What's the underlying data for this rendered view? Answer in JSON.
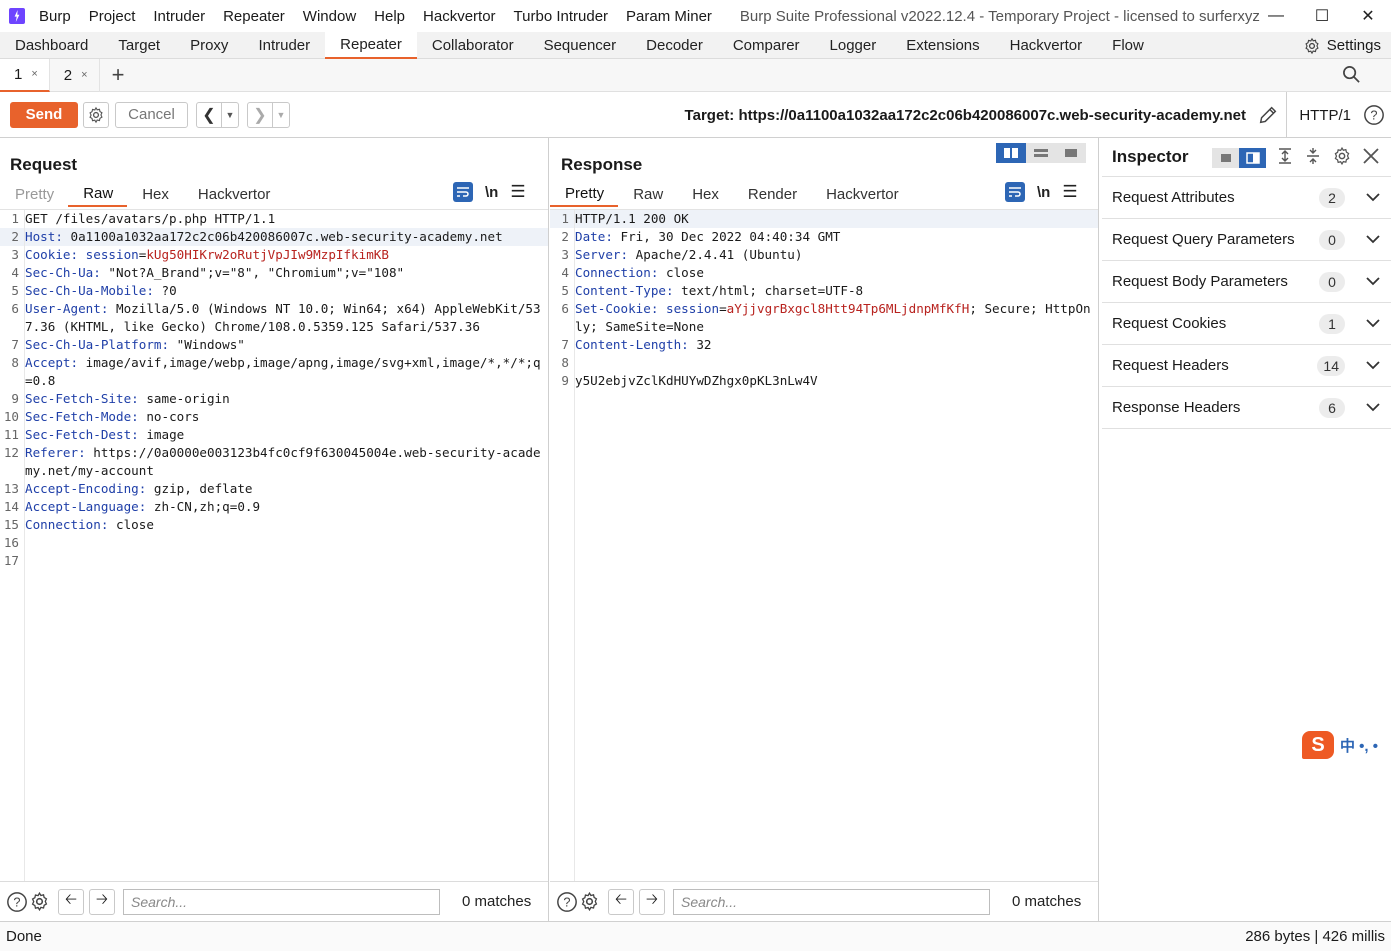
{
  "menubar": {
    "items": [
      "Burp",
      "Project",
      "Intruder",
      "Repeater",
      "Window",
      "Help",
      "Hackvertor",
      "Turbo Intruder",
      "Param Miner"
    ],
    "window_title": "Burp Suite Professional v2022.12.4 - Temporary Project - licensed to surferxyz"
  },
  "main_tabs": {
    "items": [
      "Dashboard",
      "Target",
      "Proxy",
      "Intruder",
      "Repeater",
      "Collaborator",
      "Sequencer",
      "Decoder",
      "Comparer",
      "Logger",
      "Extensions",
      "Hackvertor",
      "Flow"
    ],
    "active": "Repeater",
    "settings_label": "Settings"
  },
  "repeater_tabs": {
    "items": [
      "1",
      "2"
    ],
    "active": "1",
    "add_label": "+"
  },
  "toolbar": {
    "send_label": "Send",
    "cancel_label": "Cancel",
    "target_label": "Target: https://0a1100a1032aa172c2c06b420086007c.web-security-academy.net",
    "http_version": "HTTP/1"
  },
  "request": {
    "title": "Request",
    "tabs": [
      "Pretty",
      "Raw",
      "Hex",
      "Hackvertor"
    ],
    "active_tab": "Raw",
    "nl_label": "\\n",
    "lines": [
      {
        "n": "1",
        "parts": [
          {
            "t": "GET /files/avatars/p.php HTTP/1.1",
            "c": ""
          }
        ]
      },
      {
        "n": "2",
        "parts": [
          {
            "t": "Host:",
            "c": "hk"
          },
          {
            "t": " 0a1100a1032aa172c2c06b420086007c.web-security-academy.net",
            "c": ""
          }
        ]
      },
      {
        "n": "3",
        "parts": [
          {
            "t": "Cookie:",
            "c": "hk"
          },
          {
            "t": " ",
            "c": ""
          },
          {
            "t": "session",
            "c": "hk"
          },
          {
            "t": "=",
            "c": ""
          },
          {
            "t": "kUg50HIKrw2oRutjVpJIw9MzpIfkimKB",
            "c": "cv"
          }
        ]
      },
      {
        "n": "4",
        "parts": [
          {
            "t": "Sec-Ch-Ua:",
            "c": "hk"
          },
          {
            "t": " \"Not?A_Brand\";v=\"8\", \"Chromium\";v=\"108\"",
            "c": ""
          }
        ]
      },
      {
        "n": "5",
        "parts": [
          {
            "t": "Sec-Ch-Ua-Mobile:",
            "c": "hk"
          },
          {
            "t": " ?0",
            "c": ""
          }
        ]
      },
      {
        "n": "6",
        "parts": [
          {
            "t": "User-Agent:",
            "c": "hk"
          },
          {
            "t": " Mozilla/5.0 (Windows NT 10.0; Win64; x64) AppleWebKit/537.36 (KHTML, like Gecko) Chrome/108.0.5359.125 Safari/537.36",
            "c": ""
          }
        ]
      },
      {
        "n": "7",
        "parts": [
          {
            "t": "Sec-Ch-Ua-Platform:",
            "c": "hk"
          },
          {
            "t": " \"Windows\"",
            "c": ""
          }
        ]
      },
      {
        "n": "8",
        "parts": [
          {
            "t": "Accept:",
            "c": "hk"
          },
          {
            "t": " image/avif,image/webp,image/apng,image/svg+xml,image/*,*/*;q=0.8",
            "c": ""
          }
        ]
      },
      {
        "n": "9",
        "parts": [
          {
            "t": "Sec-Fetch-Site:",
            "c": "hk"
          },
          {
            "t": " same-origin",
            "c": ""
          }
        ]
      },
      {
        "n": "10",
        "parts": [
          {
            "t": "Sec-Fetch-Mode:",
            "c": "hk"
          },
          {
            "t": " no-cors",
            "c": ""
          }
        ]
      },
      {
        "n": "11",
        "parts": [
          {
            "t": "Sec-Fetch-Dest:",
            "c": "hk"
          },
          {
            "t": " image",
            "c": ""
          }
        ]
      },
      {
        "n": "12",
        "parts": [
          {
            "t": "Referer:",
            "c": "hk"
          },
          {
            "t": " https://0a0000e003123b4fc0cf9f630045004e.web-security-academy.net/my-account",
            "c": ""
          }
        ]
      },
      {
        "n": "13",
        "parts": [
          {
            "t": "Accept-Encoding:",
            "c": "hk"
          },
          {
            "t": " gzip, deflate",
            "c": ""
          }
        ]
      },
      {
        "n": "14",
        "parts": [
          {
            "t": "Accept-Language:",
            "c": "hk"
          },
          {
            "t": " zh-CN,zh;q=0.9",
            "c": ""
          }
        ]
      },
      {
        "n": "15",
        "parts": [
          {
            "t": "Connection:",
            "c": "hk"
          },
          {
            "t": " close",
            "c": ""
          }
        ]
      },
      {
        "n": "16",
        "parts": [
          {
            "t": "",
            "c": ""
          }
        ]
      },
      {
        "n": "17",
        "parts": [
          {
            "t": "",
            "c": ""
          }
        ]
      }
    ],
    "search_placeholder": "Search...",
    "matches": "0 matches"
  },
  "response": {
    "title": "Response",
    "tabs": [
      "Pretty",
      "Raw",
      "Hex",
      "Render",
      "Hackvertor"
    ],
    "active_tab": "Pretty",
    "nl_label": "\\n",
    "lines": [
      {
        "n": "1",
        "parts": [
          {
            "t": "HTTP/1.1 200 OK",
            "c": ""
          }
        ]
      },
      {
        "n": "2",
        "parts": [
          {
            "t": "Date:",
            "c": "hk"
          },
          {
            "t": " Fri, 30 Dec 2022 04:40:34 GMT",
            "c": ""
          }
        ]
      },
      {
        "n": "3",
        "parts": [
          {
            "t": "Server:",
            "c": "hk"
          },
          {
            "t": " Apache/2.4.41 (Ubuntu)",
            "c": ""
          }
        ]
      },
      {
        "n": "4",
        "parts": [
          {
            "t": "Connection:",
            "c": "hk"
          },
          {
            "t": " close",
            "c": ""
          }
        ]
      },
      {
        "n": "5",
        "parts": [
          {
            "t": "Content-Type:",
            "c": "hk"
          },
          {
            "t": " text/html; charset=UTF-8",
            "c": ""
          }
        ]
      },
      {
        "n": "6",
        "parts": [
          {
            "t": "Set-Cookie:",
            "c": "hk"
          },
          {
            "t": " ",
            "c": ""
          },
          {
            "t": "session",
            "c": "hk"
          },
          {
            "t": "=",
            "c": ""
          },
          {
            "t": "aYjjvgrBxgcl8Htt94Tp6MLjdnpMfKfH",
            "c": "cv"
          },
          {
            "t": "; Secure; HttpOnly; SameSite=None",
            "c": ""
          }
        ]
      },
      {
        "n": "7",
        "parts": [
          {
            "t": "Content-Length:",
            "c": "hk"
          },
          {
            "t": " 32",
            "c": ""
          }
        ]
      },
      {
        "n": "8",
        "parts": [
          {
            "t": "",
            "c": ""
          }
        ]
      },
      {
        "n": "9",
        "parts": [
          {
            "t": "y5U2ebjvZclKdHUYwDZhgx0pKL3nLw4V",
            "c": ""
          }
        ]
      }
    ],
    "search_placeholder": "Search...",
    "matches": "0 matches"
  },
  "inspector": {
    "title": "Inspector",
    "sections": [
      {
        "label": "Request Attributes",
        "count": "2"
      },
      {
        "label": "Request Query Parameters",
        "count": "0"
      },
      {
        "label": "Request Body Parameters",
        "count": "0"
      },
      {
        "label": "Request Cookies",
        "count": "1"
      },
      {
        "label": "Request Headers",
        "count": "14"
      },
      {
        "label": "Response Headers",
        "count": "6"
      }
    ]
  },
  "ime": {
    "logo": "S",
    "text": "中 •, •"
  },
  "statusbar": {
    "left": "Done",
    "right": "286 bytes | 426 millis"
  },
  "colors": {
    "accent": "#e8622c",
    "header_key": "#1f3fa8",
    "cookie_value": "#b8231f",
    "toggle_active": "#2d66b5"
  }
}
